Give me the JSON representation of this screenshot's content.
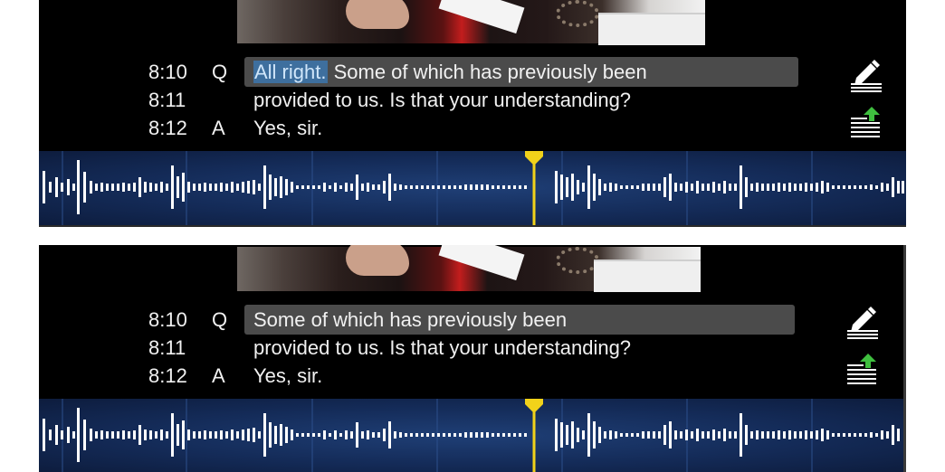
{
  "panels": [
    {
      "lines": [
        {
          "num": "8:10",
          "qa": "Q",
          "selected": "All right.",
          "text": " Some of which has previously been"
        },
        {
          "num": "8:11",
          "qa": "",
          "selected": "",
          "text": "provided to us.  Is that your understanding?"
        },
        {
          "num": "8:12",
          "qa": "A",
          "selected": "",
          "text": "Yes, sir."
        }
      ],
      "icons": {
        "edit": "edit-pencil-icon",
        "upload": "upload-lines-icon"
      }
    },
    {
      "lines": [
        {
          "num": "8:10",
          "qa": "Q",
          "selected": "",
          "text": "Some of which has previously been"
        },
        {
          "num": "8:11",
          "qa": "",
          "selected": "",
          "text": "provided to us.  Is that your understanding?"
        },
        {
          "num": "8:12",
          "qa": "A",
          "selected": "",
          "text": "Yes, sir."
        }
      ],
      "icons": {
        "edit": "edit-pencil-icon",
        "upload": "upload-lines-icon"
      }
    }
  ],
  "colors": {
    "background": "#000000",
    "highlight": "#4b4b4b",
    "selection": "#3e6f9e",
    "waveform_bg": "#142b58",
    "playhead": "#f1d21a",
    "upload_arrow": "#3fbf3f"
  }
}
